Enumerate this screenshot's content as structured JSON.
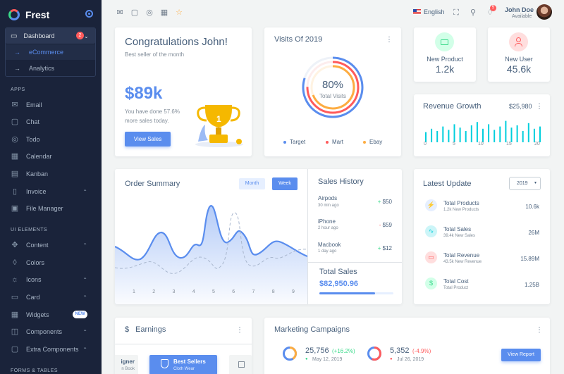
{
  "brand": {
    "name": "Frest"
  },
  "sidebar": {
    "dashboard": {
      "label": "Dashboard",
      "badge": "2"
    },
    "dashboard_items": [
      {
        "label": "eCommerce"
      },
      {
        "label": "Analytics"
      }
    ],
    "section_apps": "APPS",
    "apps": [
      {
        "label": "Email",
        "icon": "mail-icon"
      },
      {
        "label": "Chat",
        "icon": "chat-icon"
      },
      {
        "label": "Todo",
        "icon": "check-circle-icon"
      },
      {
        "label": "Calendar",
        "icon": "calendar-icon"
      },
      {
        "label": "Kanban",
        "icon": "kanban-icon"
      },
      {
        "label": "Invoice",
        "icon": "invoice-icon"
      },
      {
        "label": "File Manager",
        "icon": "save-icon"
      }
    ],
    "section_ui": "UI ELEMENTS",
    "ui": [
      {
        "label": "Content",
        "icon": "move-icon"
      },
      {
        "label": "Colors",
        "icon": "droplet-icon"
      },
      {
        "label": "Icons",
        "icon": "sun-icon"
      },
      {
        "label": "Card",
        "icon": "card-icon"
      },
      {
        "label": "Widgets",
        "icon": "widgets-icon",
        "badge": "NEW"
      },
      {
        "label": "Components",
        "icon": "layers-icon"
      },
      {
        "label": "Extra Components",
        "icon": "box-icon"
      }
    ],
    "section_forms": "FORMS & TABLES"
  },
  "header": {
    "language": "English",
    "notifications_count": "5",
    "user_name": "John Doe",
    "user_status": "Available"
  },
  "congrats": {
    "title": "Congratulations John!",
    "subtitle": "Best seller of the month",
    "amount": "$89k",
    "desc_line1": "You have done 57.6%",
    "desc_line2": "more sales today.",
    "button": "View Sales"
  },
  "visits": {
    "title": "Visits Of 2019",
    "percent": "80%",
    "label": "Total Visits",
    "legend": [
      {
        "label": "Target",
        "color": "#5a8dee"
      },
      {
        "label": "Mart",
        "color": "#ff5b5c"
      },
      {
        "label": "Ebay",
        "color": "#fdac41"
      }
    ]
  },
  "new_product": {
    "label": "New Product",
    "value": "1.2k",
    "color": "#39da8a"
  },
  "new_user": {
    "label": "New User",
    "value": "45.6k",
    "color": "#ff5b5c"
  },
  "revenue": {
    "title": "Revenue Growth",
    "value": "$25,980",
    "axis": [
      "0",
      "5",
      "10",
      "15",
      "20"
    ],
    "bars": [
      0.45,
      0.6,
      0.5,
      0.7,
      0.55,
      0.8,
      0.65,
      0.5,
      0.75,
      0.9,
      0.6,
      0.8,
      0.55,
      0.7,
      0.95,
      0.65,
      0.75,
      0.5,
      0.85,
      0.6,
      0.7
    ]
  },
  "order_summary": {
    "title": "Order Summary",
    "tab_month": "Month",
    "tab_week": "Week",
    "x_labels": [
      "1",
      "2",
      "3",
      "4",
      "5",
      "6",
      "7",
      "8",
      "9"
    ]
  },
  "sales_history": {
    "title": "Sales History",
    "items": [
      {
        "name": "Airpods",
        "time": "30 min ago",
        "amount": "+ $50",
        "sign_color": "#39da8a"
      },
      {
        "name": "iPhone",
        "time": "2 hour ago",
        "amount": "- $59",
        "sign_color": "#ff5b5c"
      },
      {
        "name": "Macbook",
        "time": "1 day ago",
        "amount": "+ $12",
        "sign_color": "#39da8a"
      }
    ],
    "total_label": "Total Sales",
    "total_value": "$82,950.96"
  },
  "latest_update": {
    "title": "Latest Update",
    "year": "2019",
    "items": [
      {
        "title": "Total Products",
        "sub": "1.2k New Products",
        "value": "10.6k",
        "icon": "zap-icon",
        "color": "#5a8dee",
        "bg": "#e6efff"
      },
      {
        "title": "Total Sales",
        "sub": "39.4k New Sales",
        "value": "26M",
        "icon": "activity-icon",
        "color": "#00cfdd",
        "bg": "#ccf5f8"
      },
      {
        "title": "Total Revenue",
        "sub": "43.5k New Revenue",
        "value": "15.89M",
        "icon": "credit-card-icon",
        "color": "#ff5b5c",
        "bg": "#ffdede"
      },
      {
        "title": "Total Cost",
        "sub": "Total Product",
        "value": "1.25B",
        "icon": "dollar-icon",
        "color": "#39da8a",
        "bg": "#d2ffe8"
      }
    ]
  },
  "earnings": {
    "title": "Earnings",
    "left_title": "igner",
    "left_sub": "n Book",
    "active_title": "Best Sellers",
    "active_sub": "Cloth Wear"
  },
  "marketing": {
    "title": "Marketing Campaigns",
    "stats": [
      {
        "value": "25,756",
        "change": "(+16.2%)",
        "change_color": "#39da8a",
        "date": "May 12, 2019"
      },
      {
        "value": "5,352",
        "change": "(-4.9%)",
        "change_color": "#ff5b5c",
        "date": "Jul 26, 2019"
      }
    ],
    "button": "View Report"
  }
}
